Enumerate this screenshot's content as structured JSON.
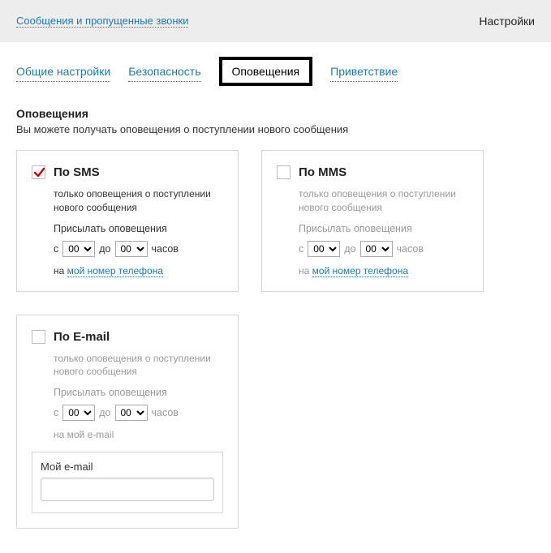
{
  "topbar": {
    "breadcrumb": "Сообщения и пропущенные звонки",
    "settings": "Настройки"
  },
  "tabs": {
    "general": "Общие настройки",
    "security": "Безопасность",
    "notifications": "Оповещения",
    "greeting": "Приветствие"
  },
  "section": {
    "title": "Оповещения",
    "desc": "Вы можете получать оповещения о поступлении нового сообщения"
  },
  "labels": {
    "note": "только оповещения о поступлении нового сообщения",
    "send": "Присылать оповещения",
    "from": "с",
    "to": "до",
    "hours": "часов",
    "to_number": "на",
    "my_number_link": "мой номер телефона",
    "to_my": "на мой",
    "email_word": "e-mail",
    "time_start": "00",
    "time_end": "00"
  },
  "cards": {
    "sms": {
      "title": "По SMS"
    },
    "mms": {
      "title": "По MMS"
    },
    "email": {
      "title": "По E-mail",
      "field_label": "Мой e-mail",
      "value": ""
    }
  }
}
